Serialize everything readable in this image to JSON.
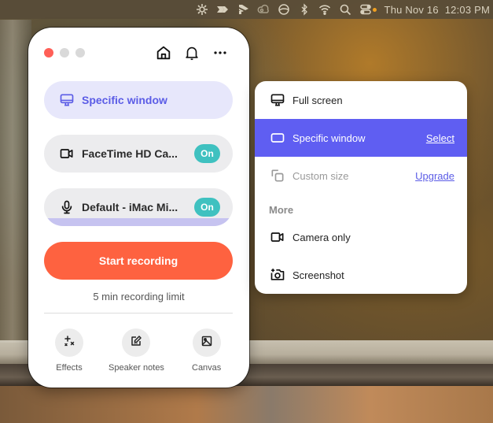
{
  "menubar": {
    "icons": [
      "sun-burst-icon",
      "arrow-app-icon",
      "stack-app-icon",
      "creative-cloud-icon",
      "circle-app-icon",
      "bluetooth-icon",
      "wifi-icon",
      "search-icon",
      "control-center-icon"
    ],
    "status_dot_color": "#f0a020",
    "date": "Thu Nov 16",
    "time": "12:03 PM"
  },
  "panel": {
    "window_controls": [
      "close",
      "minimize",
      "zoom"
    ],
    "top_icons": [
      "home-icon",
      "bell-icon",
      "more-icon"
    ],
    "mode": {
      "label": "Specific window",
      "icon": "monitor-icon"
    },
    "camera": {
      "label": "FaceTime HD Ca...",
      "toggle": "On",
      "icon": "video-camera-icon"
    },
    "microphone": {
      "label": "Default - iMac Mi...",
      "toggle": "On",
      "icon": "microphone-icon"
    },
    "start_button": "Start recording",
    "limit_text": "5 min recording limit",
    "tools": [
      {
        "label": "Effects",
        "icon": "sparkles-icon"
      },
      {
        "label": "Speaker notes",
        "icon": "edit-note-icon"
      },
      {
        "label": "Canvas",
        "icon": "image-icon"
      }
    ]
  },
  "dropdown": {
    "items": [
      {
        "label": "Full screen",
        "icon": "monitor-icon",
        "state": "normal"
      },
      {
        "label": "Specific window",
        "icon": "window-icon",
        "state": "selected",
        "link": "Select"
      },
      {
        "label": "Custom size",
        "icon": "custom-size-icon",
        "state": "disabled",
        "link": "Upgrade"
      }
    ],
    "section_label": "More",
    "more_items": [
      {
        "label": "Camera only",
        "icon": "video-camera-icon"
      },
      {
        "label": "Screenshot",
        "icon": "camera-plus-icon"
      }
    ]
  },
  "colors": {
    "accent": "#5f5ef2",
    "accent_light": "#e7e7fb",
    "record": "#fe6240",
    "toggle_on": "#3fc1c0",
    "close_dot": "#ff5f57"
  }
}
